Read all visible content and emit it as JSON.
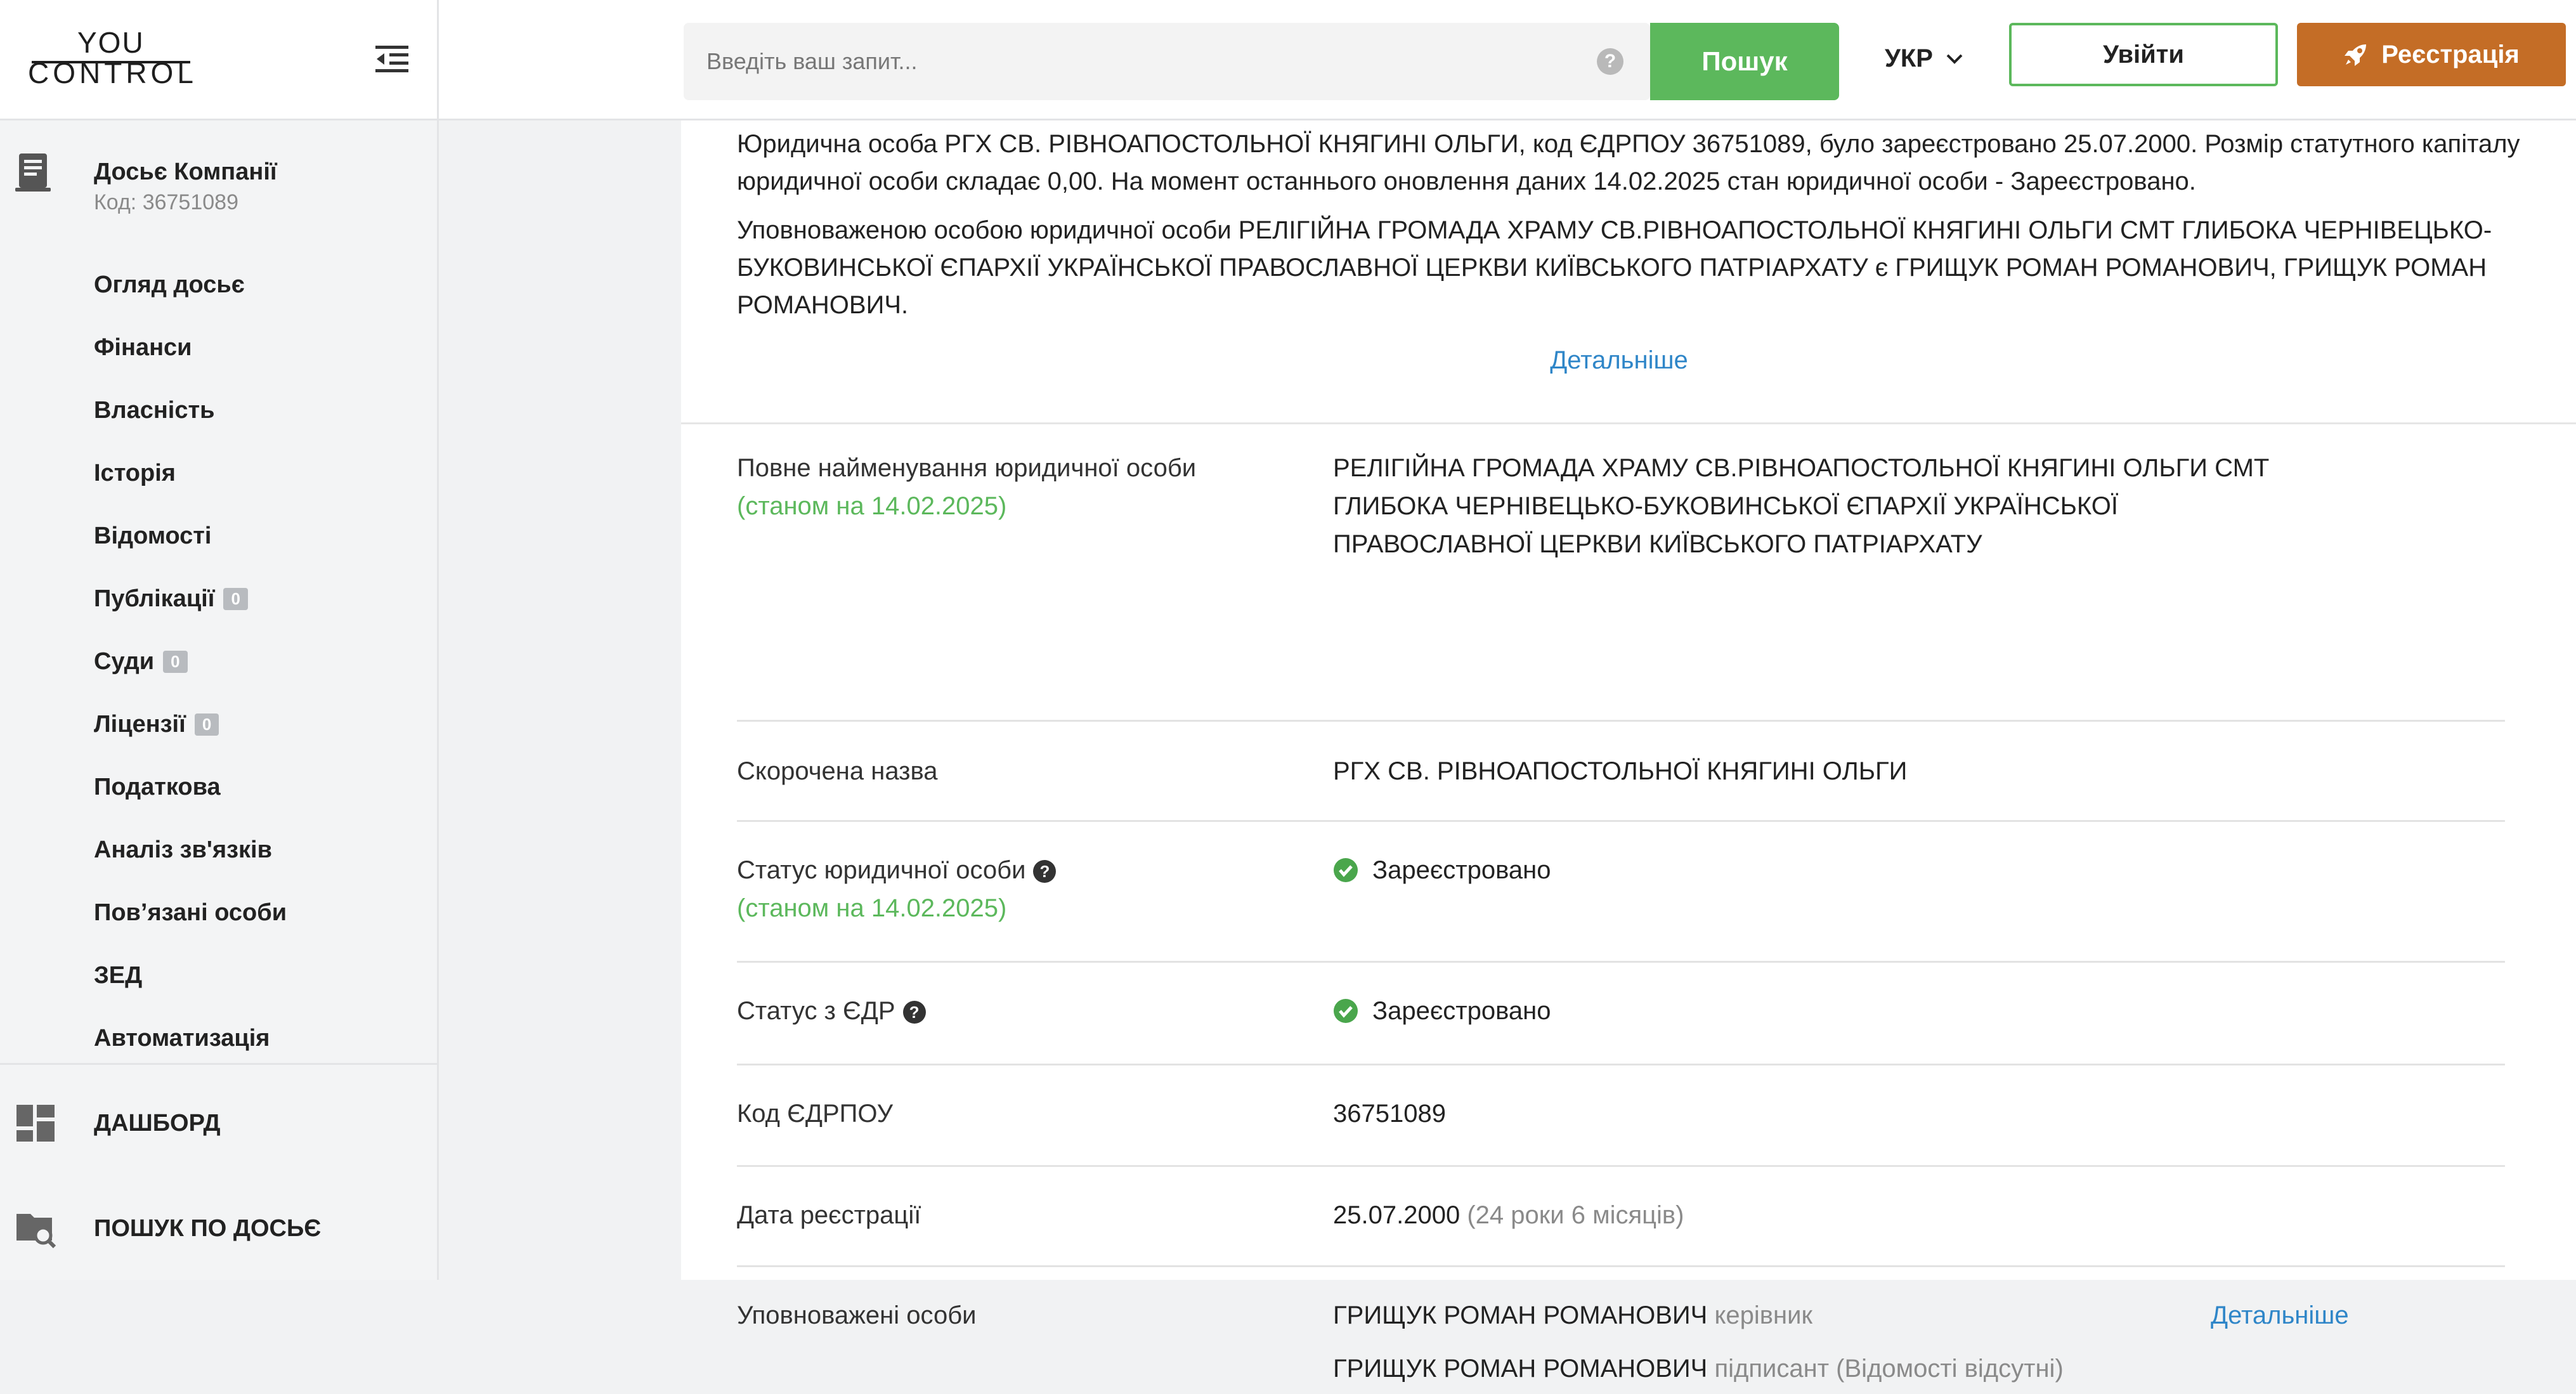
{
  "sidebar": {
    "logo": {
      "line1": "YOU",
      "line2": "CONTROL"
    },
    "dossier": {
      "title": "Досьє Компанії",
      "code": "Код: 36751089"
    },
    "items": [
      {
        "label": "Огляд досьє"
      },
      {
        "label": "Фінанси"
      },
      {
        "label": "Власність"
      },
      {
        "label": "Історія"
      },
      {
        "label": "Відомості"
      },
      {
        "label": "Публікації",
        "badge": "0"
      },
      {
        "label": "Суди",
        "badge": "0"
      },
      {
        "label": "Ліцензії",
        "badge": "0"
      },
      {
        "label": "Податкова"
      },
      {
        "label": "Аналіз зв'язків"
      },
      {
        "label": "Пов’язані особи"
      },
      {
        "label": "ЗЕД"
      },
      {
        "label": "Автоматизація"
      }
    ],
    "dashboard_label": "ДАШБОРД",
    "dossier_search_label": "ПОШУК ПО ДОСЬЄ"
  },
  "header": {
    "search_placeholder": "Введіть ваш запит...",
    "help": "?",
    "search_button": "Пошук",
    "language": "УКР",
    "login": "Увійти",
    "register": "Реєстрація"
  },
  "summary": {
    "paragraph1": "Юридична особа РГХ СВ. РІВНОАПОСТОЛЬНОЇ КНЯГИНІ ОЛЬГИ, код ЄДРПОУ 36751089, було зареєстровано 25.07.2000. Розмір статутного капіталу юридичної особи складає 0,00. На момент останнього оновлення даних 14.02.2025 стан юридичної особи - Зареєстровано.",
    "paragraph2": "Уповноваженою особою юридичної особи РЕЛІГІЙНА ГРОМАДА ХРАМУ СВ.РІВНОАПОСТОЛЬНОЇ КНЯГИНІ ОЛЬГИ СМТ ГЛИБОКА ЧЕРНІВЕЦЬКО-БУКОВИНСЬКОЇ ЄПАРХІЇ УКРАЇНСЬКОЇ ПРАВОСЛАВНОЇ ЦЕРКВИ КИЇВСЬКОГО ПАТРІАРХАТУ є ГРИЩУК РОМАН РОМАНОВИЧ, ГРИЩУК РОМАН РОМАНОВИЧ.",
    "more": "Детальніше"
  },
  "details": {
    "full_name": {
      "label": "Повне найменування юридичної особи",
      "as_of": "(станом на 14.02.2025)",
      "line1": "РЕЛІГІЙНА ГРОМАДА ХРАМУ СВ.РІВНОАПОСТОЛЬНОЇ КНЯГИНІ ОЛЬГИ СМТ",
      "line2": "ГЛИБОКА ЧЕРНІВЕЦЬКО-БУКОВИНСЬКОЇ ЄПАРХІЇ УКРАЇНСЬКОЇ",
      "line3": "ПРАВОСЛАВНОЇ ЦЕРКВИ КИЇВСЬКОГО ПАТРІАРХАТУ"
    },
    "short_name": {
      "label": "Скорочена назва",
      "value": "РГХ СВ. РІВНОАПОСТОЛЬНОЇ КНЯГИНІ ОЛЬГИ"
    },
    "status": {
      "label": "Статус юридичної особи",
      "as_of": "(станом на 14.02.2025)",
      "value": "Зареєстровано"
    },
    "edr_status": {
      "label": "Статус з ЄДР",
      "value": "Зареєстровано"
    },
    "edrpou": {
      "label": "Код ЄДРПОУ",
      "value": "36751089"
    },
    "reg_date": {
      "label": "Дата реєстрації",
      "value": "25.07.2000",
      "age": "(24 роки 6 місяців)"
    },
    "authorized": {
      "label": "Уповноважені особи",
      "p1_name": "ГРИЩУК РОМАН РОМАНОВИЧ",
      "p1_role": "керівник",
      "p2_name": "ГРИЩУК РОМАН РОМАНОВИЧ",
      "p2_role": "підписант (Відомості відсутні)",
      "more": "Детальніше"
    }
  },
  "colors": {
    "green": "#5cb85c",
    "orange": "#c46d26",
    "link": "#2f86c8"
  }
}
